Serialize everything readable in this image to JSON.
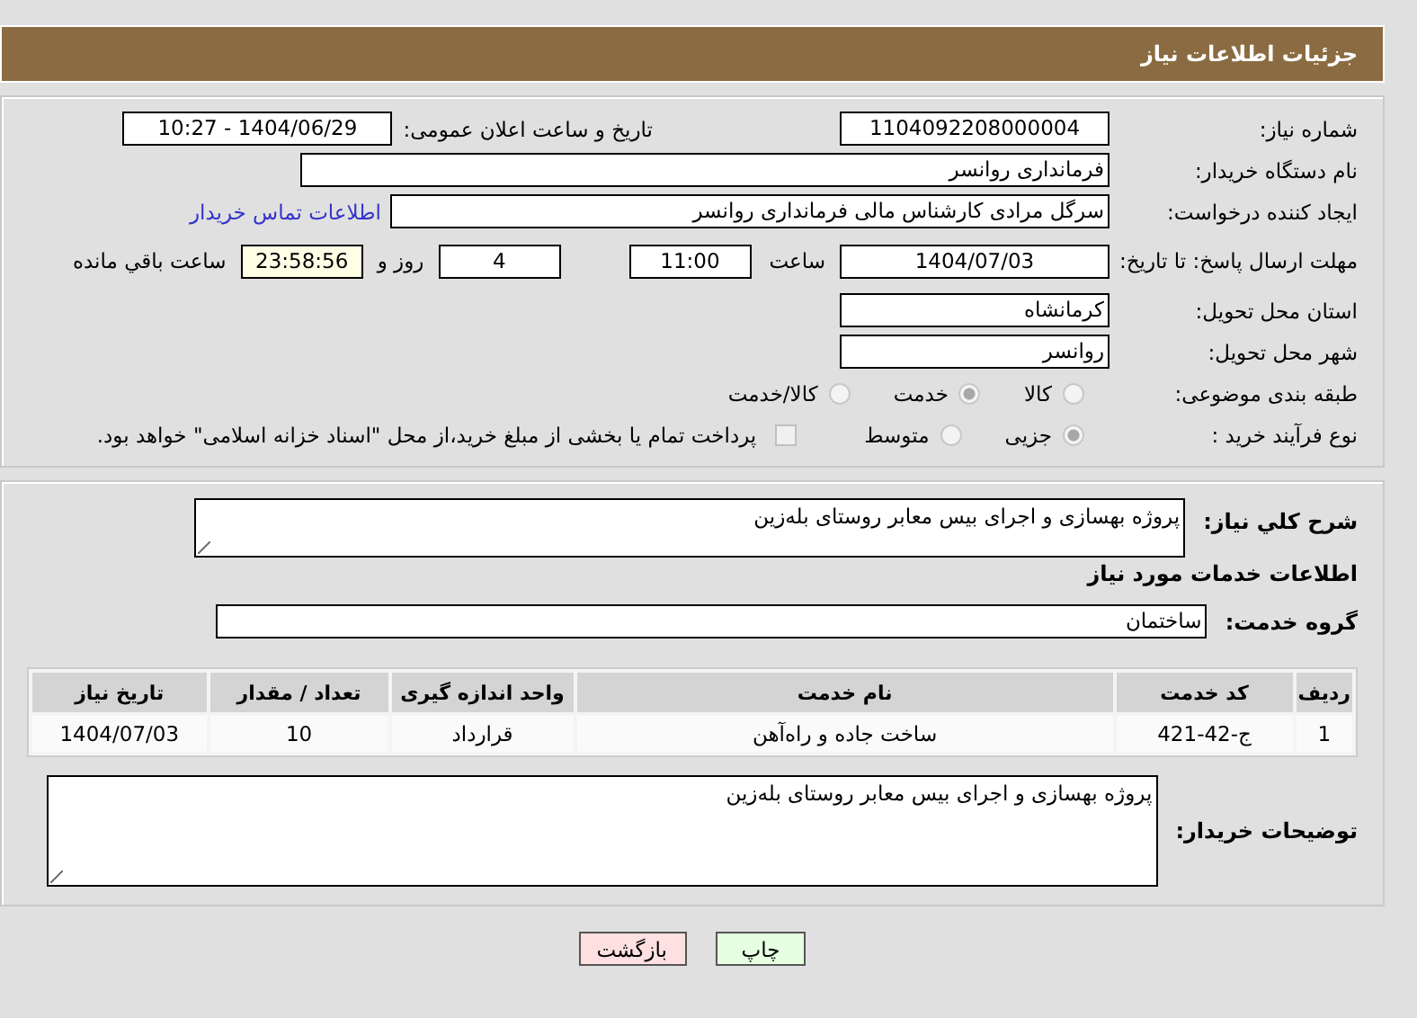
{
  "header": {
    "title": "جزئیات اطلاعات نیاز"
  },
  "need_number": {
    "label": "شماره نیاز:",
    "value": "1104092208000004"
  },
  "announce": {
    "label": "تاریخ و ساعت اعلان عمومی:",
    "value": "1404/06/29 - 10:27"
  },
  "buyer_org": {
    "label": "نام دستگاه خریدار:",
    "value": "فرمانداری روانسر"
  },
  "requester": {
    "label": "ایجاد کننده درخواست:",
    "value": "سرگل مرادی کارشناس مالی فرمانداری روانسر",
    "contact_link": "اطلاعات تماس خریدار"
  },
  "deadline": {
    "label": "مهلت ارسال پاسخ: تا تاریخ:",
    "date": "1404/07/03",
    "time_label": "ساعت",
    "time": "11:00",
    "days": "4",
    "days_label": "روز و",
    "remaining": "23:58:56",
    "remaining_label": "ساعت باقي مانده"
  },
  "province": {
    "label": "استان محل تحویل:",
    "value": "کرمانشاه"
  },
  "city": {
    "label": "شهر محل تحویل:",
    "value": "روانسر"
  },
  "category": {
    "label": "طبقه بندی موضوعی:",
    "options": [
      {
        "label": "کالا",
        "selected": false
      },
      {
        "label": "خدمت",
        "selected": true
      },
      {
        "label": "کالا/خدمت",
        "selected": false
      }
    ]
  },
  "process": {
    "label": "نوع فرآیند خرید :",
    "options": [
      {
        "label": "جزیی",
        "selected": true
      },
      {
        "label": "متوسط",
        "selected": false
      }
    ],
    "treasury": {
      "checked": false,
      "label": "پرداخت تمام یا بخشی از مبلغ خرید،از محل \"اسناد خزانه اسلامی\" خواهد بود."
    }
  },
  "description": {
    "label": "شرح کلي نياز:",
    "value": "پروژه بهسازی و اجرای بیس معابر روستای بله‌زین"
  },
  "services_heading": "اطلاعات خدمات مورد نیاز",
  "service_group": {
    "label": "گروه خدمت:",
    "value": "ساختمان"
  },
  "table": {
    "columns": [
      "ردیف",
      "کد خدمت",
      "نام خدمت",
      "واحد اندازه گیری",
      "تعداد / مقدار",
      "تاریخ نیاز"
    ],
    "rows": [
      [
        "1",
        "ج-42-421",
        "ساخت جاده و راه‌آهن",
        "قرارداد",
        "10",
        "1404/07/03"
      ]
    ]
  },
  "buyer_notes": {
    "label": "توضیحات خریدار:",
    "value": "پروژه بهسازی و اجرای بیس  معابر روستای بله‌زین"
  },
  "buttons": [
    {
      "label": "چاپ",
      "kind": "print"
    },
    {
      "label": "بازگشت",
      "kind": "back"
    }
  ]
}
